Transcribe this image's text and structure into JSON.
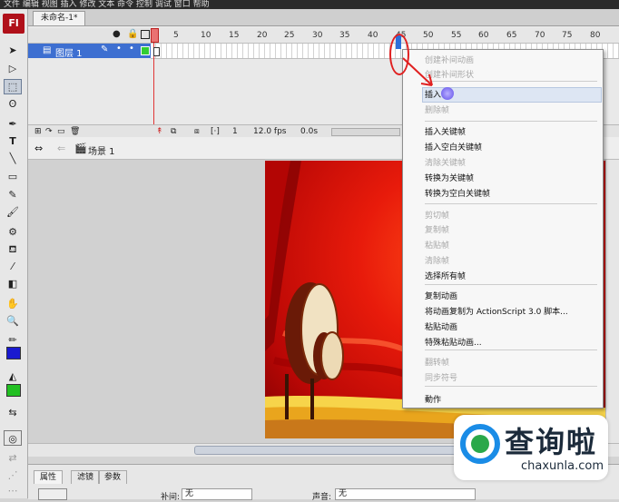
{
  "top_strip": {
    "text": "文件  编辑  视图  插入  修改  文本  命令  控制  调试  窗口  帮助"
  },
  "app": {
    "logo": "Fl"
  },
  "document": {
    "tab_title": "未命名-1*"
  },
  "timeline": {
    "layer_name": "图层 1",
    "ruler_ticks": [
      "5",
      "10",
      "15",
      "20",
      "25",
      "30",
      "35",
      "40",
      "45",
      "50",
      "55",
      "60",
      "65",
      "70",
      "75",
      "80"
    ],
    "current_frame": "1",
    "fps": "12.0 fps",
    "time": "0.0s"
  },
  "scene": {
    "label": "场景 1"
  },
  "context_menu": {
    "items": [
      {
        "label": "创建补间动画",
        "enabled": false
      },
      {
        "label": "创建补间形状",
        "enabled": false
      },
      {
        "label": "插入帧",
        "enabled": true,
        "highlighted": true
      },
      {
        "label": "删除帧",
        "enabled": false
      },
      {
        "label": "插入关键帧",
        "enabled": true
      },
      {
        "label": "插入空白关键帧",
        "enabled": true
      },
      {
        "label": "清除关键帧",
        "enabled": false
      },
      {
        "label": "转换为关键帧",
        "enabled": true
      },
      {
        "label": "转换为空白关键帧",
        "enabled": true
      },
      {
        "label": "剪切帧",
        "enabled": false
      },
      {
        "label": "复制帧",
        "enabled": false
      },
      {
        "label": "粘贴帧",
        "enabled": false
      },
      {
        "label": "清除帧",
        "enabled": false
      },
      {
        "label": "选择所有帧",
        "enabled": true
      },
      {
        "label": "复制动画",
        "enabled": true
      },
      {
        "label": "将动画复制为 ActionScript 3.0 脚本...",
        "enabled": true
      },
      {
        "label": "粘贴动画",
        "enabled": true
      },
      {
        "label": "特殊粘贴动画...",
        "enabled": true
      },
      {
        "label": "翻转帧",
        "enabled": false
      },
      {
        "label": "同步符号",
        "enabled": false
      },
      {
        "label": "動作",
        "enabled": true
      }
    ]
  },
  "properties": {
    "tabs": [
      "属性",
      "滤镜",
      "参数"
    ],
    "tween_label": "补间:",
    "tween_value": "无",
    "sound_label": "声音:",
    "sound_value": "无"
  },
  "watermark": {
    "title": "查询啦",
    "url": "chaxunla.com"
  },
  "colors": {
    "accent": "#3d6fd1",
    "annotation_red": "#e02020",
    "stage_red": "#e81b0b",
    "stroke_color": "#1a1ad0",
    "fill_color": "#22c022"
  }
}
